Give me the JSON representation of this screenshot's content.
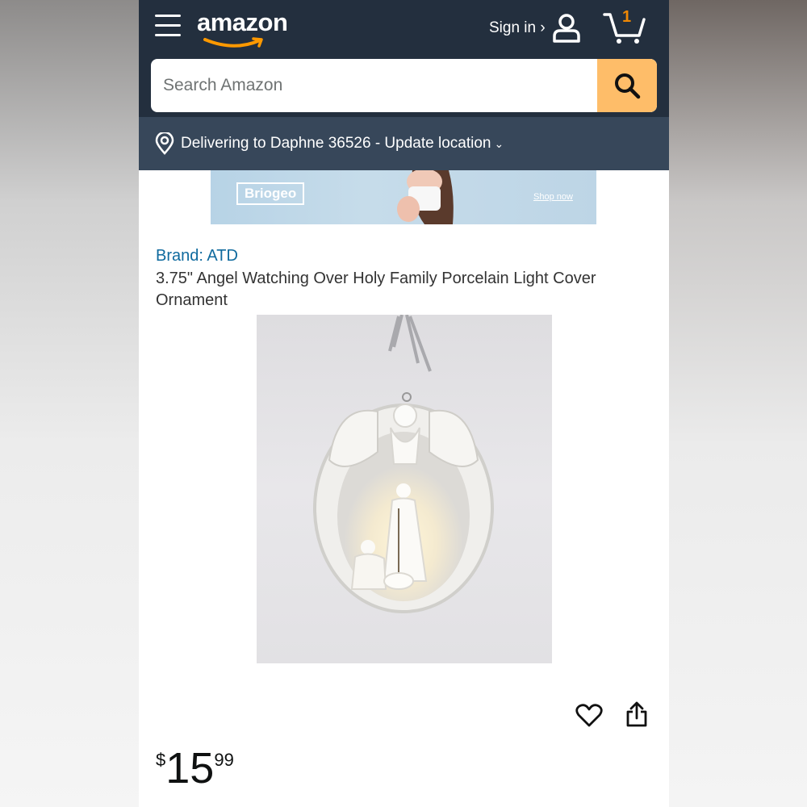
{
  "header": {
    "logo_text": "amazon",
    "signin_label": "Sign in ›",
    "cart_count": "1",
    "colors": {
      "header_bg": "#232f3e",
      "search_button": "#febd69",
      "deliver_bg": "#37475a"
    }
  },
  "search": {
    "placeholder": "Search Amazon"
  },
  "delivery": {
    "label": "Delivering to Daphne 36526 - Update location",
    "chevron": "⌄"
  },
  "ad": {
    "brand": "Briogeo",
    "cta": "Shop now"
  },
  "product": {
    "brand_label": "Brand: ATD",
    "title": "3.75\" Angel Watching Over Holy Family Porcelain Light Cover Ornament",
    "price_symbol": "$",
    "price_whole": "15",
    "price_fraction": "99"
  },
  "icons": [
    "menu-icon",
    "user-icon",
    "cart-icon",
    "search-icon",
    "location-pin-icon",
    "heart-icon",
    "share-icon"
  ]
}
